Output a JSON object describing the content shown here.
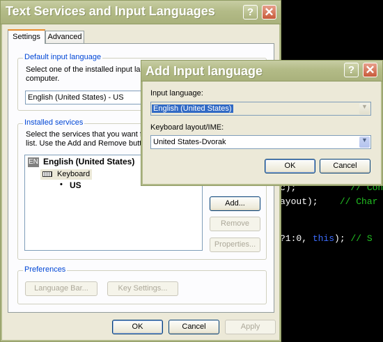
{
  "code_editor": {
    "lines": [
      {
        "code": "c);",
        "comment": "// Conv"
      },
      {
        "code": "ayout);",
        "comment": "// Char"
      },
      {
        "code_prefix": "?1:0, ",
        "keyword": "this",
        "code_suffix": "); ",
        "comment": "// S"
      }
    ]
  },
  "main_dialog": {
    "title": "Text Services and Input Languages",
    "help_glyph": "?",
    "close_glyph": "✕",
    "tabs": [
      "Settings",
      "Advanced"
    ],
    "default_input": {
      "legend": "Default input language",
      "description_line1": "Select one of the installed input lang",
      "description_line2": "computer.",
      "selected": "English (United States) - US"
    },
    "installed_services": {
      "legend": "Installed services",
      "description_line1": "Select the services that you want fo",
      "description_line2": "list. Use the Add and Remove butto",
      "language_code": "EN",
      "language_name": "English (United States)",
      "category": "Keyboard",
      "layout": "US",
      "bullet": "•",
      "add_label": "Add...",
      "remove_label": "Remove",
      "properties_label": "Properties..."
    },
    "preferences": {
      "legend": "Preferences",
      "language_bar_label": "Language Bar...",
      "key_settings_label": "Key Settings..."
    },
    "ok_label": "OK",
    "cancel_label": "Cancel",
    "apply_label": "Apply"
  },
  "add_dialog": {
    "title": "Add Input language",
    "help_glyph": "?",
    "close_glyph": "✕",
    "input_language_label": "Input language:",
    "input_language_value": "English (United States)",
    "keyboard_layout_label": "Keyboard layout/IME:",
    "keyboard_layout_value": "United States-Dvorak",
    "ok_label": "OK",
    "cancel_label": "Cancel"
  },
  "icons": {
    "dropdown_arrow": "▼"
  }
}
